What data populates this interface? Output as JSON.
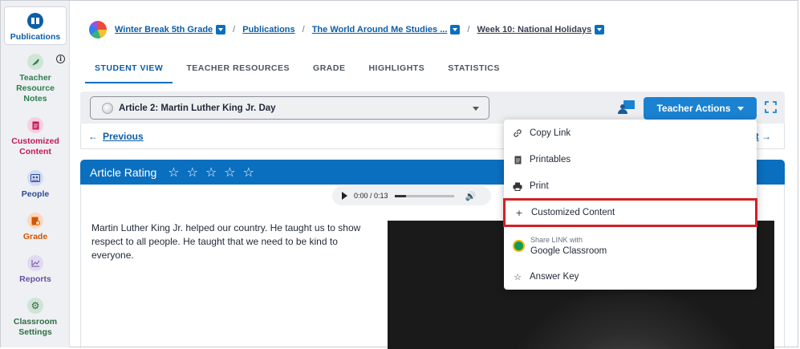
{
  "sidebar": {
    "items": [
      {
        "label": "Publications",
        "color": "#0b5ea8",
        "icon": "book-icon"
      },
      {
        "label": "Teacher Resource Notes",
        "color": "#2f7d4f",
        "icon": "feather-icon"
      },
      {
        "label": "Customized Content",
        "color": "#c2185b",
        "icon": "document-icon"
      },
      {
        "label": "People",
        "color": "#2c4a9a",
        "icon": "people-icon"
      },
      {
        "label": "Grade",
        "color": "#d35400",
        "icon": "grade-icon"
      },
      {
        "label": "Reports",
        "color": "#6b4fa0",
        "icon": "chart-icon"
      },
      {
        "label": "Classroom Settings",
        "color": "#2f6d46",
        "icon": "gear-icon"
      }
    ]
  },
  "breadcrumb": {
    "items": [
      "Winter Break 5th Grade",
      "Publications",
      "The World Around Me Studies ...",
      "Week 10: National Holidays"
    ],
    "separator": "/"
  },
  "tabs": [
    "STUDENT VIEW",
    "TEACHER RESOURCES",
    "GRADE",
    "HIGHLIGHTS",
    "STATISTICS"
  ],
  "toolbar": {
    "article": "Article 2: Martin Luther King Jr. Day",
    "teacher_actions": "Teacher Actions"
  },
  "pager": {
    "previous": "Previous",
    "next_partial": "xt"
  },
  "rating": {
    "title": "Article Rating",
    "stars": [
      "☆",
      "☆",
      "☆",
      "☆",
      "☆"
    ]
  },
  "audio": {
    "time": "0:00 / 0:13",
    "progress": 0.2
  },
  "article": {
    "body": "Martin Luther King Jr. helped our country. He taught us to show respect to all people. He taught that we need to be kind to everyone."
  },
  "menu": {
    "copy_link": "Copy Link",
    "printables": "Printables",
    "print": "Print",
    "customized_content": "Customized Content",
    "share_label": "Share LINK with",
    "google_classroom": "Google Classroom",
    "answer_key": "Answer Key"
  },
  "colors": {
    "accent": "#0b6fbf",
    "highlight": "#d32027"
  }
}
